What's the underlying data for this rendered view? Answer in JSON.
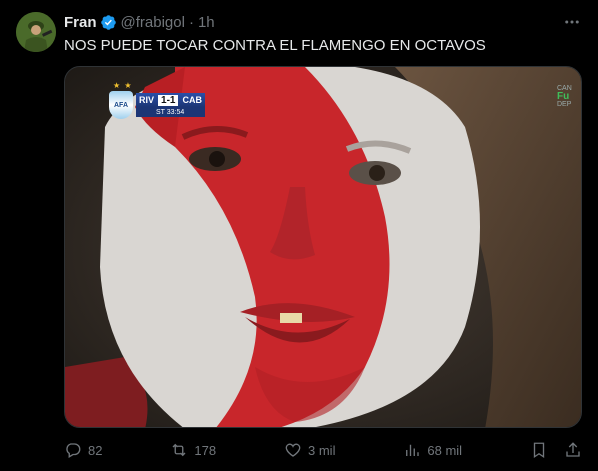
{
  "tweet": {
    "author": {
      "name": "Fran",
      "handle": "@frabigol",
      "verified": true,
      "avatar_icon": "avatar-soldier-icon"
    },
    "separator": "·",
    "time": "1h",
    "more_icon": "more-horizontal-icon",
    "text": "NOS PUEDE TOCAR CONTRA EL FLAMENGO EN OCTAVOS",
    "media": {
      "kind": "photo",
      "description_icon": "photo",
      "scorebug": {
        "stars": "★ ★",
        "crest": "AFA",
        "home": "RIV",
        "score": "1-1",
        "away": "CAB",
        "clock": "ST 33:54"
      },
      "channel": {
        "top": "CAN",
        "big": "Fu",
        "bottom": "DEP"
      }
    },
    "actions": {
      "reply": {
        "icon": "reply-icon",
        "count": "82"
      },
      "retweet": {
        "icon": "retweet-icon",
        "count": "178"
      },
      "like": {
        "icon": "heart-icon",
        "count": "3 mil"
      },
      "views": {
        "icon": "views-chart-icon",
        "count": "68 mil"
      },
      "bookmark": {
        "icon": "bookmark-icon"
      },
      "share": {
        "icon": "share-icon"
      }
    }
  },
  "colors": {
    "background": "#000000",
    "text": "#e7e9ea",
    "muted": "#71767b",
    "verified": "#1d9bf0",
    "border": "#2f3336"
  }
}
